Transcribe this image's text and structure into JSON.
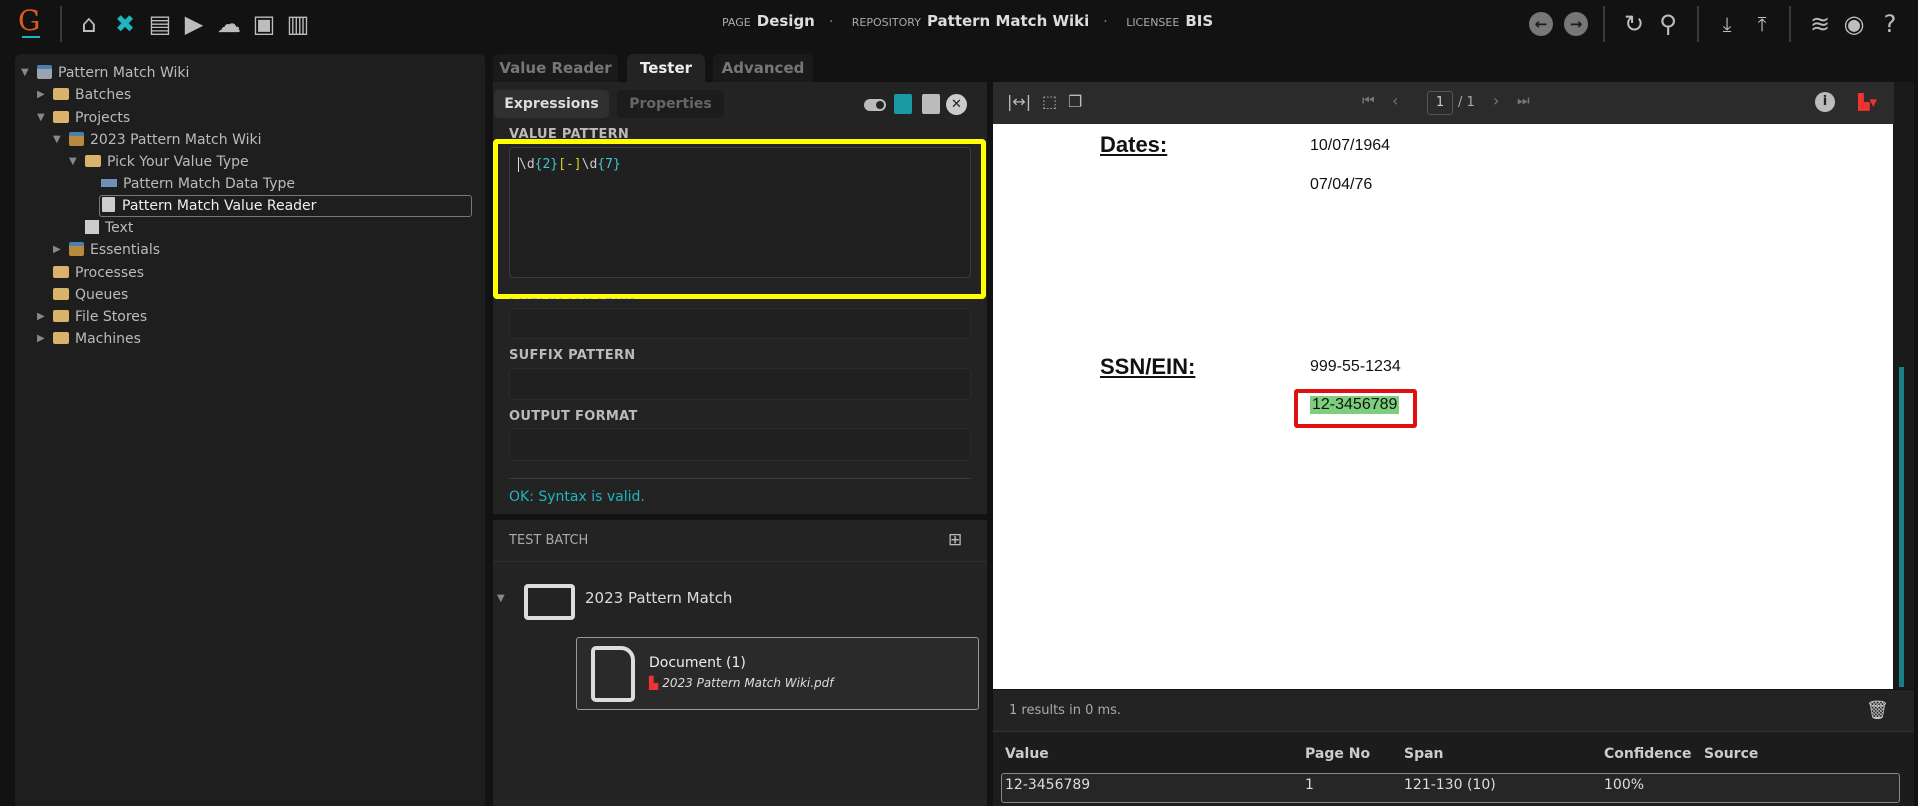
{
  "header": {
    "logo": "G",
    "nav_icons": [
      "home-icon",
      "tools-icon",
      "archive-icon",
      "media-icon",
      "cloud-upload-icon",
      "briefcase-clock-icon",
      "bar-chart-icon"
    ],
    "page_label": "PAGE",
    "page_value": "Design",
    "repository_label": "REPOSITORY",
    "repository_value": "Pattern Match Wiki",
    "licensee_label": "LICENSEE",
    "licensee_value": "BIS",
    "right_icons": [
      "back-icon",
      "forward-icon",
      "refresh-icon",
      "search-icon",
      "download-icon",
      "upload-icon",
      "database-icon",
      "user-icon",
      "help-icon"
    ]
  },
  "tree": {
    "items": [
      {
        "label": "Pattern Match Wiki",
        "icon": "repository"
      },
      {
        "label": "Batches",
        "icon": "folder"
      },
      {
        "label": "Projects",
        "icon": "folder"
      },
      {
        "label": "2023 Pattern Match Wiki",
        "icon": "package"
      },
      {
        "label": "Pick Your Value Type",
        "icon": "folder"
      },
      {
        "label": "Pattern Match Data Type",
        "icon": "data-type"
      },
      {
        "label": "Pattern Match Value Reader",
        "icon": "value-reader"
      },
      {
        "label": "Text",
        "icon": "text"
      },
      {
        "label": "Essentials",
        "icon": "package"
      },
      {
        "label": "Processes",
        "icon": "folder"
      },
      {
        "label": "Queues",
        "icon": "folder"
      },
      {
        "label": "File Stores",
        "icon": "folder"
      },
      {
        "label": "Machines",
        "icon": "folder"
      }
    ]
  },
  "tabs": [
    "Value Reader",
    "Tester",
    "Advanced"
  ],
  "subtabs": [
    "Expressions",
    "Properties"
  ],
  "editor": {
    "value_pattern_label": "VALUE PATTERN",
    "pattern_parts": [
      "\\d",
      "{2}",
      "[-]",
      "\\d",
      "{7}"
    ],
    "prefix_label": "PREFIX PATTERN",
    "suffix_label": "SUFFIX PATTERN",
    "output_label": "OUTPUT FORMAT",
    "status": "OK: Syntax is valid."
  },
  "test_batch": {
    "title": "TEST BATCH",
    "folder": "2023 Pattern Match",
    "document_title": "Document (1)",
    "document_file": "2023 Pattern Match Wiki.pdf"
  },
  "viewer": {
    "page_current": "1",
    "page_total": "/ 1",
    "doc": {
      "dates_label": "Dates:",
      "date1": "10/07/1964",
      "date2": "07/04/76",
      "ssn_label": "SSN/EIN:",
      "ssn1": "999-55-1234",
      "ein": "12-3456789"
    }
  },
  "results": {
    "summary": "1 results in 0 ms.",
    "columns": [
      "Value",
      "Page No",
      "Span",
      "Confidence",
      "Source"
    ],
    "rows": [
      {
        "value": "12-3456789",
        "page": "1",
        "span": "121-130 (10)",
        "confidence": "100%",
        "source": ""
      }
    ]
  },
  "colors": {
    "accent": "#1fb5c0",
    "highlight_yellow": "#ffff00",
    "match_red": "#e01010",
    "match_green": "#7ccf7c"
  }
}
